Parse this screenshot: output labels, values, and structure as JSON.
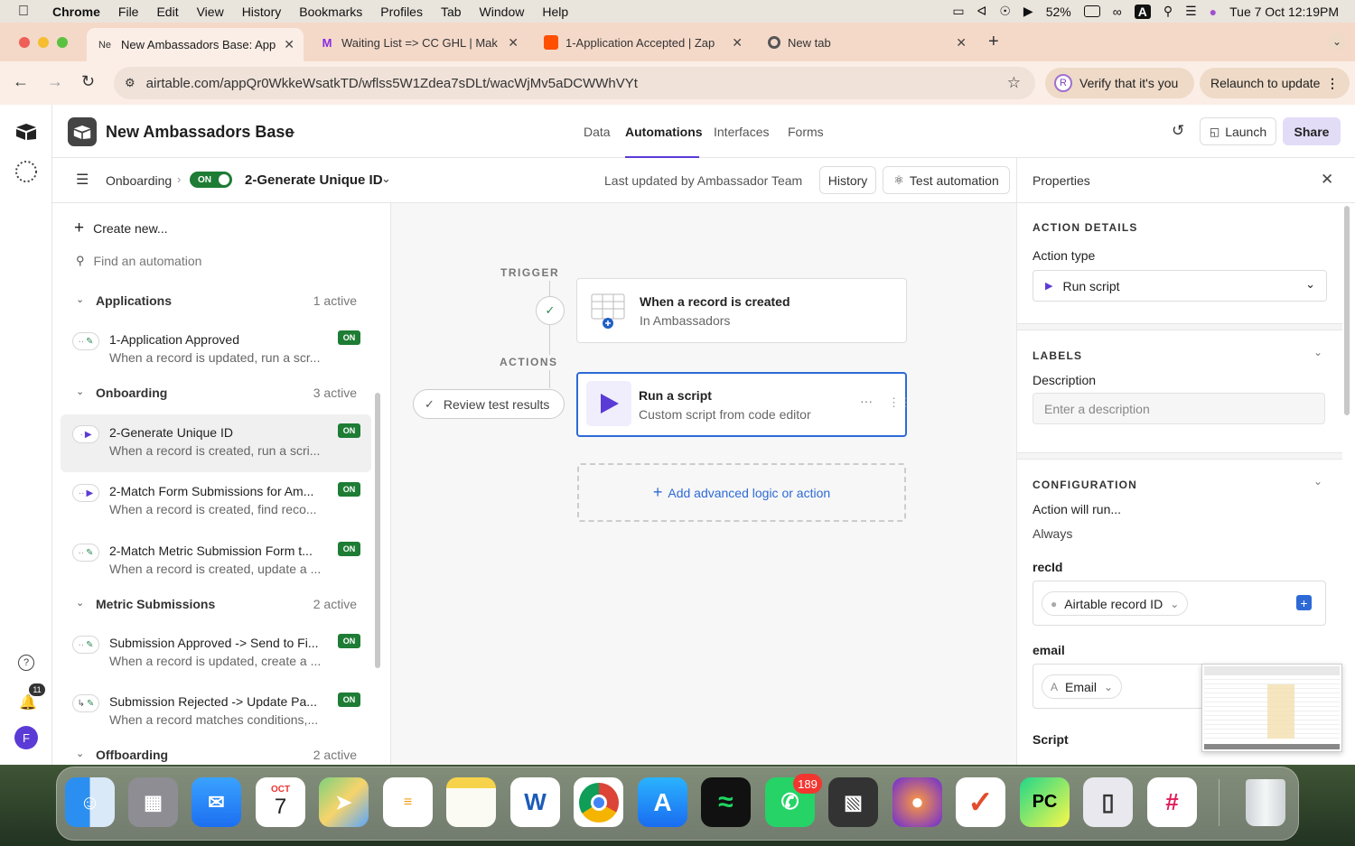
{
  "menubar": {
    "app": "Chrome",
    "items": [
      "File",
      "Edit",
      "View",
      "History",
      "Bookmarks",
      "Profiles",
      "Tab",
      "Window",
      "Help"
    ],
    "battery": "52%",
    "datetime": "Tue 7 Oct  12:19PM"
  },
  "browser": {
    "tabs": [
      {
        "title": "New Ambassadors Base: App",
        "fav": "Ne"
      },
      {
        "title": "Waiting List => CC GHL | Mak",
        "fav": "M"
      },
      {
        "title": "1-Application Accepted | Zap",
        "fav": ""
      },
      {
        "title": "New tab",
        "fav": ""
      }
    ],
    "url": "airtable.com/appQr0WkkeWsatkTD/wflss5W1Zdea7sDLt/wacWjMv5aDCWWhVYt",
    "verify_label": "Verify that it's you",
    "verify_avatar": "R",
    "relaunch_label": "Relaunch to update"
  },
  "header": {
    "base_name": "New Ambassadors Base",
    "nav": [
      "Data",
      "Automations",
      "Interfaces",
      "Forms"
    ],
    "launch": "Launch",
    "share": "Share"
  },
  "subheader": {
    "group": "Onboarding",
    "toggle": "ON",
    "automation_name": "2-Generate Unique ID",
    "last_updated": "Last updated by Ambassador Team",
    "history": "History",
    "test": "Test automation"
  },
  "sidebar": {
    "create": "Create new...",
    "search_placeholder": "Find an automation",
    "groups": [
      {
        "name": "Applications",
        "count": "1 active"
      },
      {
        "name": "Onboarding",
        "count": "3 active"
      },
      {
        "name": "Metric Submissions",
        "count": "2 active"
      },
      {
        "name": "Offboarding",
        "count": "2 active"
      }
    ],
    "items": [
      {
        "title": "1-Application Approved",
        "desc": "When a record is updated, run a scr...",
        "badge": "ON"
      },
      {
        "title": "2-Generate Unique ID",
        "desc": "When a record is created, run a scri...",
        "badge": "ON"
      },
      {
        "title": "2-Match Form Submissions for Am...",
        "desc": "When a record is created, find reco...",
        "badge": "ON"
      },
      {
        "title": "2-Match Metric Submission Form t...",
        "desc": "When a record is created, update a ...",
        "badge": "ON"
      },
      {
        "title": "Submission Approved -> Send to Fi...",
        "desc": "When a record is updated, create a ...",
        "badge": "ON"
      },
      {
        "title": "Submission Rejected -> Update Pa...",
        "desc": "When a record matches conditions,...",
        "badge": "ON"
      }
    ]
  },
  "canvas": {
    "trigger_label": "TRIGGER",
    "actions_label": "ACTIONS",
    "trigger_title": "When a record is created",
    "trigger_sub": "In Ambassadors",
    "review": "Review test results",
    "action_title": "Run a script",
    "action_sub": "Custom script from code editor",
    "add": "Add advanced logic or action"
  },
  "panel": {
    "title": "Properties",
    "action_details": "ACTION DETAILS",
    "action_type_label": "Action type",
    "action_type": "Run script",
    "labels": "LABELS",
    "description_label": "Description",
    "description_placeholder": "Enter a description",
    "configuration": "CONFIGURATION",
    "will_run_label": "Action will run...",
    "will_run": "Always",
    "recid_label": "recId",
    "recid_value": "Airtable record ID",
    "email_label": "email",
    "email_value": "Email",
    "script_label": "Script"
  },
  "rail": {
    "notifications": "11",
    "avatar": "F"
  },
  "dock": {
    "calendar_month": "OCT",
    "calendar_day": "7",
    "whatsapp_badge": "189"
  },
  "colors": {
    "accent": "#5b3bd6",
    "on_green": "#1e7c34",
    "selected_border": "#2d6ad6",
    "link_blue": "#2d6ad6"
  }
}
